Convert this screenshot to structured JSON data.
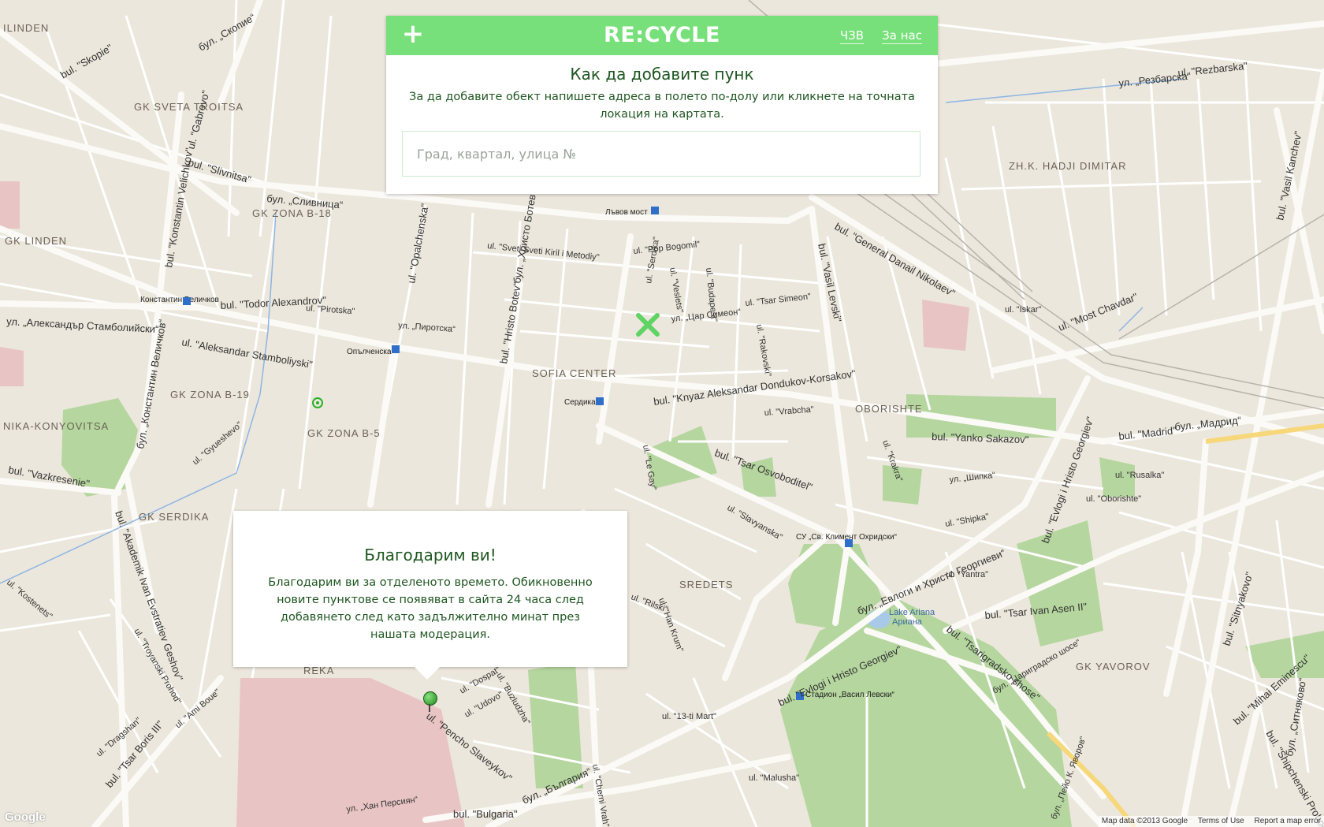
{
  "header": {
    "logo": "RE:CYCLE",
    "nav": [
      "ЧЗВ",
      "За нас"
    ]
  },
  "add_point": {
    "title": "Как да добавите пунк",
    "description": "За да добавите обект напишете адреса в полето по-долу или кликнете на точната локация на картата.",
    "search_placeholder": "Град, квартал, улица №",
    "search_value": ""
  },
  "thanks_popup": {
    "title": "Благодарим ви!",
    "message": "Благодарим ви за отделеното времето. Обикновенно новите пунктове се появяват в сайта 24 часа след добавянето след като задължително минат през нашата модерация."
  },
  "map": {
    "districts": [
      "ILINDEN",
      "GK SVETA TROITSA",
      "GK ZONA B-18",
      "GK LINDEN",
      "SOFIA CENTER",
      "GK ZONA B-19",
      "GK ZONA B-5",
      "NIKA-KONYOVITSA",
      "GK SERDIKA",
      "OBORISHTE",
      "ZH.K. HADJI DIMITAR",
      "SREDETS",
      "GK YAVOROV",
      "REKA"
    ],
    "metro": [
      "Лъвов мост",
      "Константин Величков",
      "Опълченска",
      "Сердика",
      "СУ „Св. Климент Охридски“",
      "Стадион „Васил Левски“"
    ],
    "streets": [
      "bul. \"Slivnitsa\"",
      "бул. „Сливница“",
      "bul. \"Todor Alexandrov\"",
      "ul. \"Aleksandar Stamboliyski\"",
      "ул. „Александър Стамболийски“",
      "bul. \"Knyaz Aleksandar Dondukov-Korsakov\"",
      "bul. \"Tsar Osvoboditel\"",
      "bul. \"Vasil Levski\"",
      "bul. \"General Danail Nikolaev\"",
      "bul. \"Yanko Sakazov\"",
      "bul. \"Madrid\"",
      "бул. „Мадрид“",
      "bul. \"Evlogi i Hristo Georgiev\"",
      "бул. „Евлоги и Христо Георгиеви“",
      "bul. \"Tsar Ivan Asen II\"",
      "bul. \"Tsarigradsko shose\"",
      "bul. \"Vazkresenie\"",
      "bul. \"Akademik Ivan Evstratiev Geshov\"",
      "bul. \"Tsar Boris III\"",
      "ul. \"Pencho Slaveykov\"",
      "bul. \"Bulgaria\"",
      "бул. „България“",
      "ul. \"Most Chavdar\"",
      "ul. \"Rezbarska\"",
      "ул. „Резбарска“",
      "bul. \"Skopie\"",
      "бул. „Скопие“",
      "ul. \"Gabrovo\"",
      "bul. \"Konstantin Velichkov\"",
      "бул. „Константин Величков“",
      "bul. \"Hristo Botev\"",
      "бул. „Христо Ботев“",
      "ul. \"Opalchenska\"",
      "bul. \"Mihai Eminescu\"",
      "bul. \"Shipchenski Prohod\"",
      "bul. \"Sitnyakovo\"",
      "бул. „Ситняково“",
      "bul. \"Vasil Kanchev\"",
      "bul. \"Evlogi i Hristo Georgiev\"",
      "ul. \"Tsar Simeon\"",
      "ул. „Цар Симеон“",
      "ul. \"Pop Bogomil\"",
      "ul. \"Iskar\"",
      "ul. \"Sveti Sveti Kiril i Metodiy\"",
      "ul. \"Pirotska\"",
      "ул. „Пиротска“",
      "ul. \"Vrabcha\"",
      "ul. \"Shipka\"",
      "ул. „Шипка“",
      "ul. \"Oborishte\"",
      "ul. \"Slavyanska\"",
      "ul. \"Rakovski\"",
      "ul. \"Krakra\"",
      "ul. \"Rusalka\"",
      "ul. \"Yantra\"",
      "ul. \"13-ti Mart\"",
      "ul. \"Malusha\"",
      "ul. \"Cherni Vrah\"",
      "ul. \"Han Krum\"",
      "ul. \"Rilski\"",
      "ul. \"Le Gay\"",
      "ul. \"Serdika\"",
      "ul. \"Veslets\"",
      "ul. \"Budapest\"",
      "ul. \"Dospat\"",
      "ul. \"Udovo\"",
      "ul. \"Buzludzha\"",
      "ul. \"Dragshan\"",
      "ul. \"Ami Boue\"",
      "ул. „Хан Персиян“",
      "бул. „Цариградско шосе“",
      "бул. „Пейо К. Яворов“",
      "ul. \"Gyueshevo\"",
      "ul. \"Kostenets\"",
      "ul. \"Troyanski Prohod\""
    ],
    "lake": "Lake Ariana",
    "lake_local": "Ариана"
  },
  "footer": {
    "copyright": "Map data ©2013 Google",
    "terms": "Terms of Use",
    "report": "Report a map error",
    "brand": "Google"
  },
  "colors": {
    "accent": "#77e07a",
    "text_dark_green": "#1e5620",
    "map_bg": "#ece7dc",
    "park": "#b5d69e",
    "hospital": "#e9c4c4"
  }
}
